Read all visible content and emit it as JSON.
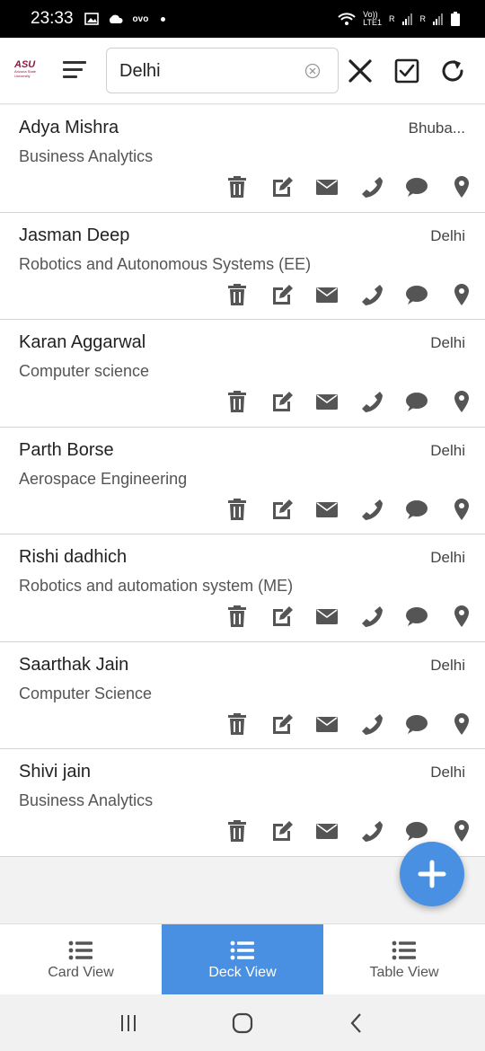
{
  "status_bar": {
    "time": "23:33",
    "carrier_label": "ovo",
    "network_label": "LTE1",
    "volte_label": "Vo))",
    "roaming_1": "R",
    "roaming_2": "R"
  },
  "app_bar": {
    "logo_text": "ASU",
    "logo_subtext": "Arizona State University",
    "search": {
      "value": "Delhi",
      "placeholder": ""
    }
  },
  "contacts": [
    {
      "name": "Adya Mishra",
      "course": "Business Analytics",
      "city": "Bhuba..."
    },
    {
      "name": "Jasman Deep",
      "course": "Robotics and Autonomous Systems (EE)",
      "city": "Delhi"
    },
    {
      "name": "Karan Aggarwal",
      "course": "Computer science",
      "city": "Delhi"
    },
    {
      "name": "Parth Borse",
      "course": "Aerospace Engineering",
      "city": "Delhi"
    },
    {
      "name": "Rishi dadhich",
      "course": "Robotics and automation system (ME)",
      "city": "Delhi"
    },
    {
      "name": "Saarthak Jain",
      "course": "Computer Science",
      "city": "Delhi"
    },
    {
      "name": "Shivi jain",
      "course": "Business Analytics",
      "city": "Delhi"
    }
  ],
  "tabs": [
    {
      "label": "Card View",
      "active": false
    },
    {
      "label": "Deck View",
      "active": true
    },
    {
      "label": "Table View",
      "active": false
    }
  ],
  "colors": {
    "accent": "#4a90e2",
    "icon": "#555555",
    "asu_maroon": "#8c1d40"
  }
}
